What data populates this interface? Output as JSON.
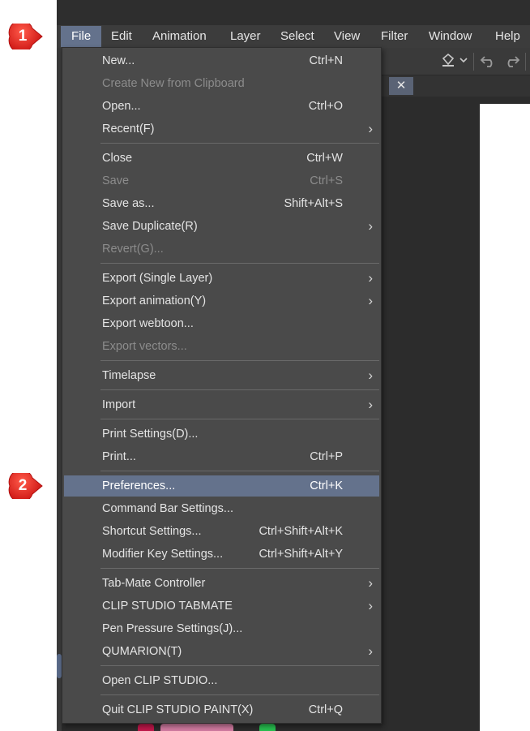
{
  "menubar": {
    "items": [
      {
        "label": "File"
      },
      {
        "label": "Edit"
      },
      {
        "label": "Animation"
      },
      {
        "label": "Layer"
      },
      {
        "label": "Select"
      },
      {
        "label": "View"
      },
      {
        "label": "Filter"
      },
      {
        "label": "Window"
      },
      {
        "label": "Help"
      }
    ]
  },
  "toolbar": {
    "icons": [
      "bucket-icon",
      "dropdown-caret-icon",
      "undo-icon",
      "redo-icon",
      "loading-spinner-icon"
    ]
  },
  "tab": {
    "close_glyph": "✕"
  },
  "file_menu": {
    "items": [
      {
        "label": "New...",
        "shortcut": "Ctrl+N"
      },
      {
        "label": "Create New from Clipboard",
        "shortcut": "",
        "disabled": true
      },
      {
        "label": "Open...",
        "shortcut": "Ctrl+O"
      },
      {
        "label": "Recent(F)",
        "shortcut": "",
        "submenu": true
      },
      {
        "label": "Close",
        "shortcut": "Ctrl+W"
      },
      {
        "label": "Save",
        "shortcut": "Ctrl+S",
        "disabled": true
      },
      {
        "label": "Save as...",
        "shortcut": "Shift+Alt+S"
      },
      {
        "label": "Save Duplicate(R)",
        "shortcut": "",
        "submenu": true
      },
      {
        "label": "Revert(G)...",
        "shortcut": "",
        "disabled": true
      },
      {
        "label": "Export (Single Layer)",
        "shortcut": "",
        "submenu": true
      },
      {
        "label": "Export animation(Y)",
        "shortcut": "",
        "submenu": true
      },
      {
        "label": "Export webtoon...",
        "shortcut": ""
      },
      {
        "label": "Export vectors...",
        "shortcut": "",
        "disabled": true
      },
      {
        "label": "Timelapse",
        "shortcut": "",
        "submenu": true
      },
      {
        "label": "Import",
        "shortcut": "",
        "submenu": true
      },
      {
        "label": "Print Settings(D)...",
        "shortcut": ""
      },
      {
        "label": "Print...",
        "shortcut": "Ctrl+P"
      },
      {
        "label": "Preferences...",
        "shortcut": "Ctrl+K",
        "highlighted": true
      },
      {
        "label": "Command Bar Settings...",
        "shortcut": ""
      },
      {
        "label": "Shortcut Settings...",
        "shortcut": "Ctrl+Shift+Alt+K"
      },
      {
        "label": "Modifier Key Settings...",
        "shortcut": "Ctrl+Shift+Alt+Y"
      },
      {
        "label": "Tab-Mate Controller",
        "shortcut": "",
        "submenu": true
      },
      {
        "label": "CLIP STUDIO TABMATE",
        "shortcut": "",
        "submenu": true
      },
      {
        "label": "Pen Pressure Settings(J)...",
        "shortcut": ""
      },
      {
        "label": "QUMARION(T)",
        "shortcut": "",
        "submenu": true
      },
      {
        "label": "Open CLIP STUDIO...",
        "shortcut": ""
      },
      {
        "label": "Quit CLIP STUDIO PAINT(X)",
        "shortcut": "Ctrl+Q"
      }
    ],
    "submenu_arrow": "›"
  },
  "annotations": {
    "step1": "1",
    "step2": "2",
    "color": "#e01b1b"
  }
}
